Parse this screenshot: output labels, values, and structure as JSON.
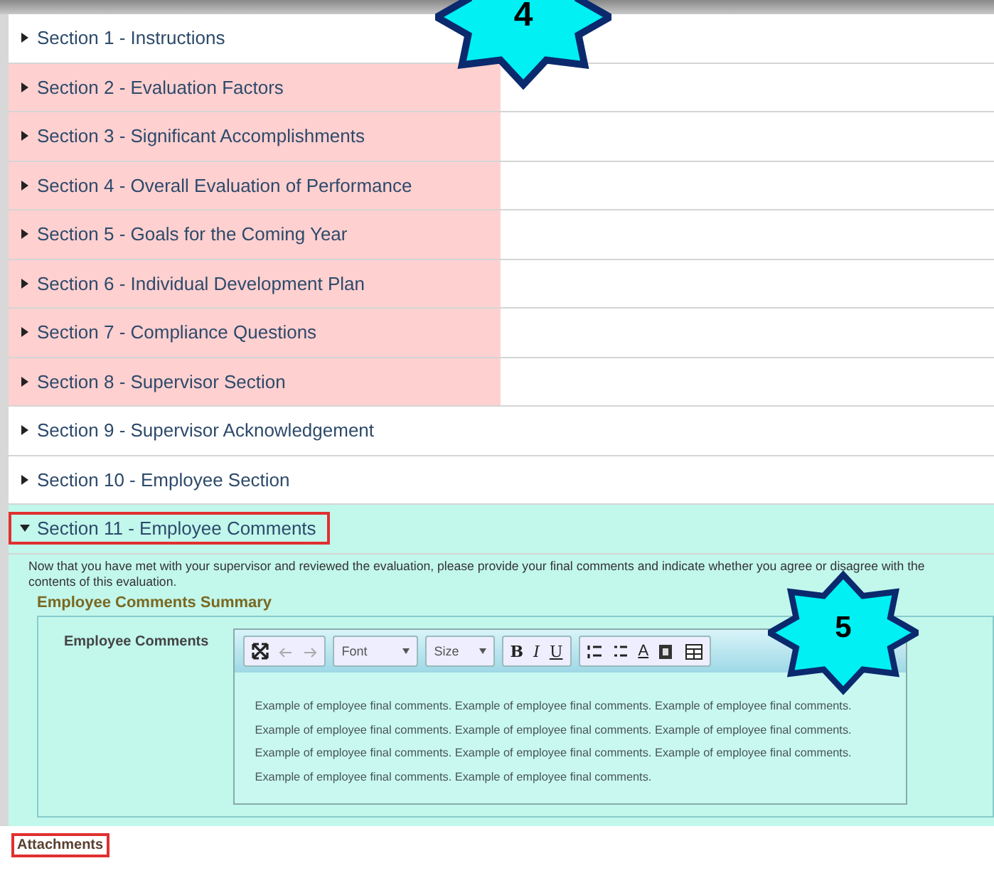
{
  "sections": [
    {
      "label": "Section 1 - Instructions",
      "expanded": false,
      "highlighted": false,
      "outlined": false
    },
    {
      "label": "Section 2 - Evaluation Factors",
      "expanded": false,
      "highlighted": true,
      "outlined": false
    },
    {
      "label": "Section 3 - Significant Accomplishments",
      "expanded": false,
      "highlighted": true,
      "outlined": false
    },
    {
      "label": "Section 4 - Overall Evaluation of Performance",
      "expanded": false,
      "highlighted": true,
      "outlined": false
    },
    {
      "label": "Section 5 - Goals for the Coming Year",
      "expanded": false,
      "highlighted": true,
      "outlined": false
    },
    {
      "label": "Section 6 - Individual Development Plan",
      "expanded": false,
      "highlighted": true,
      "outlined": false
    },
    {
      "label": "Section 7 - Compliance Questions",
      "expanded": false,
      "highlighted": true,
      "outlined": false
    },
    {
      "label": "Section 8 - Supervisor Section",
      "expanded": false,
      "highlighted": true,
      "outlined": false
    },
    {
      "label": "Section 9 - Supervisor Acknowledgement",
      "expanded": false,
      "highlighted": false,
      "outlined": false
    },
    {
      "label": "Section 10 - Employee Section",
      "expanded": false,
      "highlighted": false,
      "outlined": false
    },
    {
      "label": "Section 11 - Employee Comments",
      "expanded": true,
      "highlighted": false,
      "outlined": true
    }
  ],
  "expanded_section": {
    "intro": "Now that you have met with your supervisor and reviewed the evaluation, please provide your final comments and indicate whether you agree or disagree with the contents of this evaluation.",
    "summary_title": "Employee Comments Summary",
    "field_label": "Employee Comments",
    "toolbar": {
      "font": "Font",
      "size": "Size",
      "bold": "B",
      "italic": "I",
      "underline": "U",
      "text_color": "A"
    },
    "value": "Example of employee final comments. Example of employee final comments. Example of employee final comments. Example of employee final comments. Example of employee final comments. Example of employee final comments. Example of employee final comments. Example of employee final comments. Example of employee final comments. Example of employee final comments. Example of employee final comments."
  },
  "attachments": {
    "label": "Attachments",
    "outlined": true
  },
  "callouts": [
    {
      "number": "4"
    },
    {
      "number": "5"
    }
  ]
}
